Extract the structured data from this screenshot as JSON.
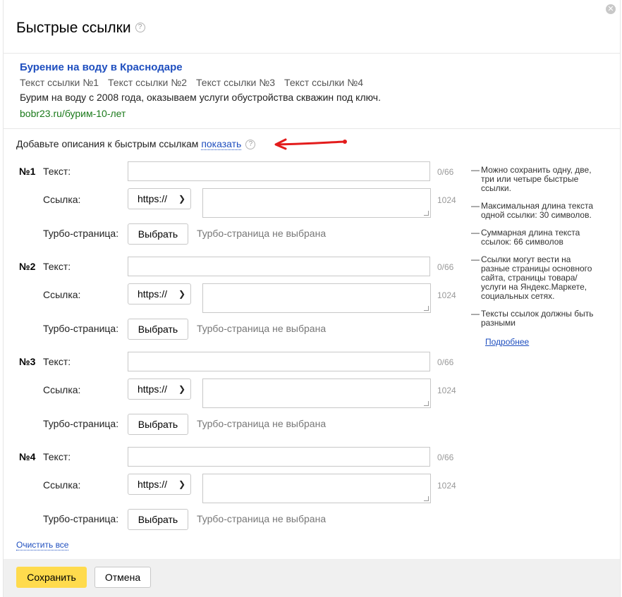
{
  "dialog": {
    "title": "Быстрые ссылки",
    "help_glyph": "?",
    "close_glyph": "✕"
  },
  "preview": {
    "title": "Бурение на воду в Краснодаре",
    "links": [
      "Текст ссылки №1",
      "Текст ссылки №2",
      "Текст ссылки №3",
      "Текст ссылки №4"
    ],
    "description": "Бурим на воду с 2008 года, оказываем услуги обустройства скважин под ключ.",
    "url": "bobr23.ru/бурим-10-лет"
  },
  "hint": {
    "text": "Добавьте описания к быстрым ссылкам",
    "link": "показать"
  },
  "annotation": {
    "arrow_color": "#e31c1c"
  },
  "labels": {
    "text": "Текст:",
    "link": "Ссылка:",
    "turbo": "Турбо-страница:"
  },
  "quick_links": [
    {
      "number": "№1",
      "text_value": "",
      "text_counter": "0/66",
      "protocol": "https://",
      "url_value": "",
      "url_counter": "1024",
      "turbo_button": "Выбрать",
      "turbo_status": "Турбо-страница не выбрана"
    },
    {
      "number": "№2",
      "text_value": "",
      "text_counter": "0/66",
      "protocol": "https://",
      "url_value": "",
      "url_counter": "1024",
      "turbo_button": "Выбрать",
      "turbo_status": "Турбо-страница не выбрана"
    },
    {
      "number": "№3",
      "text_value": "",
      "text_counter": "0/66",
      "protocol": "https://",
      "url_value": "",
      "url_counter": "1024",
      "turbo_button": "Выбрать",
      "turbo_status": "Турбо-страница не выбрана"
    },
    {
      "number": "№4",
      "text_value": "",
      "text_counter": "0/66",
      "protocol": "https://",
      "url_value": "",
      "url_counter": "1024",
      "turbo_button": "Выбрать",
      "turbo_status": "Турбо-страница не выбрана"
    }
  ],
  "sidebar": {
    "tips": [
      "Можно сохранить одну, две, три или четыре быстрые ссылки.",
      "Максимальная длина текста одной ссылки: 30 символов.",
      "Суммарная длина текста ссылок: 66 символов",
      "Ссылки могут вести на разные страницы основного сайта, страницы товара/услуги на Яндекс.Маркете, социальных сетях.",
      "Тексты ссылок должны быть разными"
    ],
    "more_link": "Подробнее"
  },
  "clear_all": "Очистить все",
  "footer": {
    "save": "Сохранить",
    "cancel": "Отмена"
  }
}
